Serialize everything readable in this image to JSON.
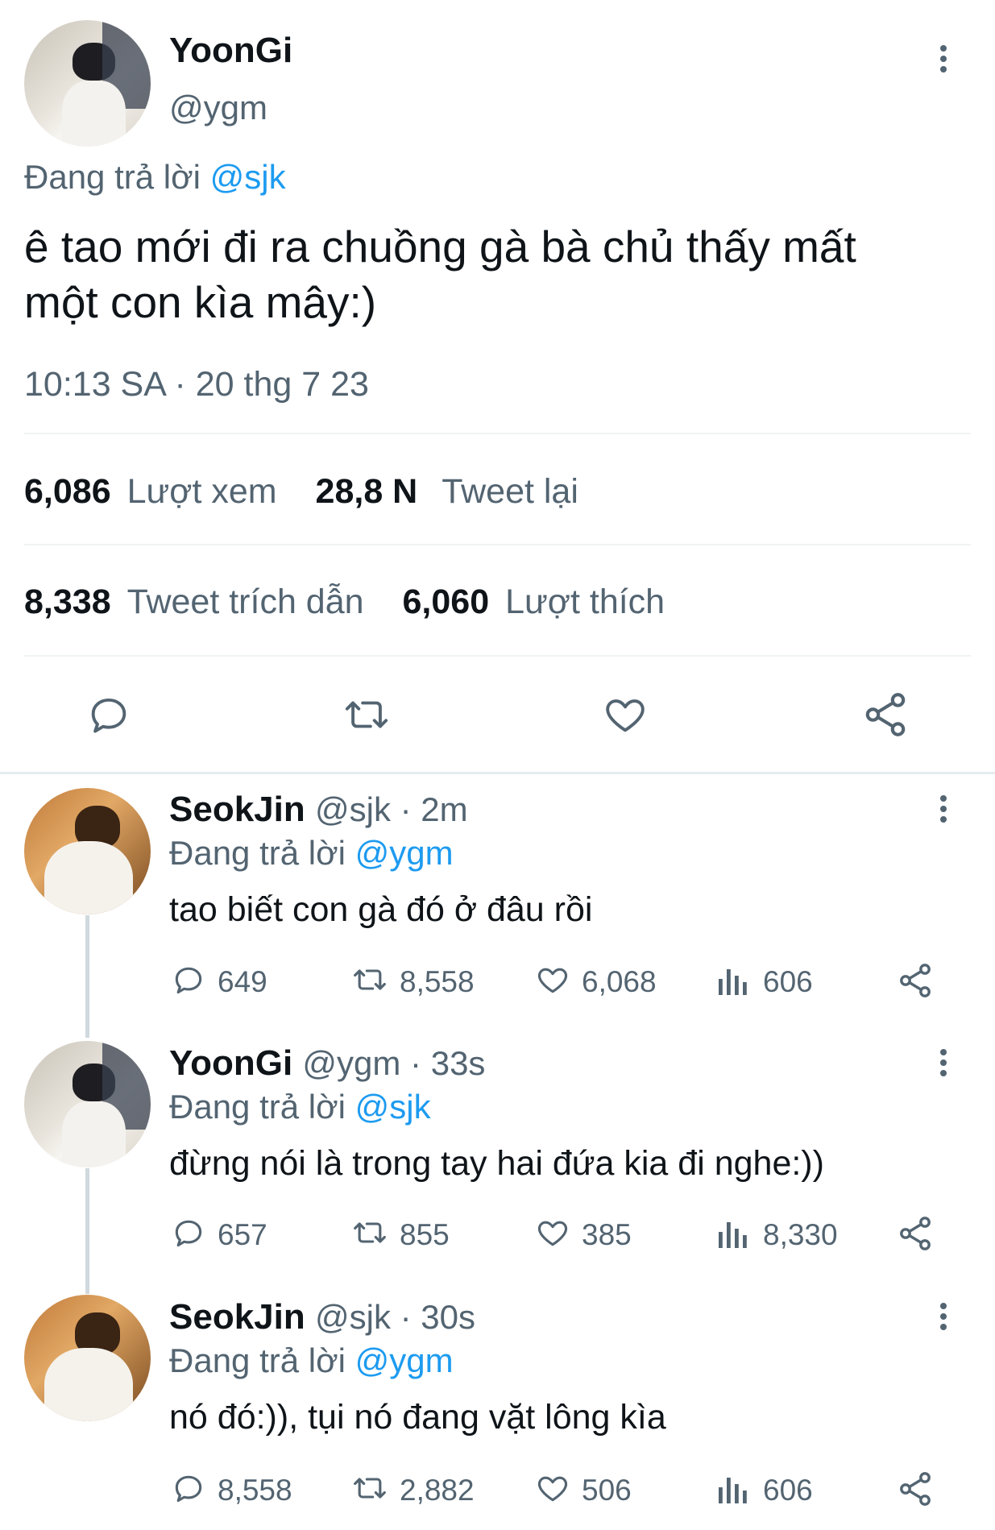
{
  "main_tweet": {
    "display_name": "YoonGi",
    "handle": "@ygm",
    "replying_to_prefix": "Đang trả lời",
    "replying_to_handle": "@sjk",
    "text_line1": "ê tao mới đi ra chuồng gà bà chủ thấy mất",
    "text_line2": "một con kìa mây:)",
    "timestamp": "10:13 SA · 20 thg 7 23",
    "stats": {
      "views_count": "6,086",
      "views_label": "Lượt xem",
      "retweets_count": "28,8 N",
      "retweets_label": "Tweet lại",
      "quotes_count": "8,338",
      "quotes_label": "Tweet trích dẫn",
      "likes_count": "6,060",
      "likes_label": "Lượt thích"
    }
  },
  "replies": [
    {
      "display_name": "SeokJin",
      "handle_time": "@sjk · 2m",
      "replying_to_prefix": "Đang trả lời",
      "replying_to_handle": "@ygm",
      "text": "tao biết con gà đó ở đâu rồi",
      "replies": "649",
      "retweets": "8,558",
      "likes": "6,068",
      "views": "606"
    },
    {
      "display_name": "YoonGi",
      "handle_time": "@ygm · 33s",
      "replying_to_prefix": "Đang trả lời",
      "replying_to_handle": "@sjk",
      "text": "đừng nói là trong tay hai đứa kia đi nghe:))",
      "replies": "657",
      "retweets": "855",
      "likes": "385",
      "views": "8,330"
    },
    {
      "display_name": "SeokJin",
      "handle_time": "@sjk · 30s",
      "replying_to_prefix": "Đang trả lời",
      "replying_to_handle": "@ygm",
      "text": "nó đó:)), tụi nó đang vặt lông kìa",
      "replies": "8,558",
      "retweets": "2,882",
      "likes": "506",
      "views": "606"
    }
  ],
  "icons": [
    "more-icon",
    "reply-icon",
    "retweet-icon",
    "like-icon",
    "share-icon",
    "views-icon"
  ],
  "colors": {
    "accent": "#1d9bf0",
    "muted": "#536471",
    "text": "#0f1419",
    "divider": "#eff3f4"
  }
}
